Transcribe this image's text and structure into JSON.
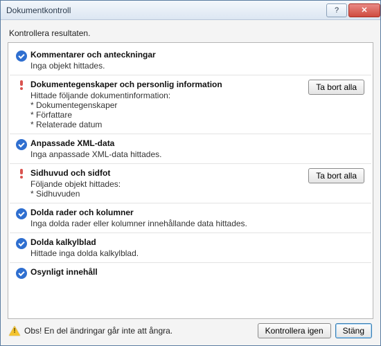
{
  "window": {
    "title": "Dokumentkontroll"
  },
  "instruction": "Kontrollera resultaten.",
  "items": [
    {
      "status": "ok",
      "title": "Kommentarer och anteckningar",
      "message": "Inga objekt hittades.",
      "details": [],
      "action": null
    },
    {
      "status": "warn",
      "title": "Dokumentegenskaper och personlig information",
      "message": "Hittade följande dokumentinformation:",
      "details": [
        "* Dokumentegenskaper",
        "* Författare",
        "* Relaterade datum"
      ],
      "action": "Ta bort alla"
    },
    {
      "status": "ok",
      "title": "Anpassade XML-data",
      "message": "Inga anpassade XML-data hittades.",
      "details": [],
      "action": null
    },
    {
      "status": "warn",
      "title": "Sidhuvud och sidfot",
      "message": "Följande objekt hittades:",
      "details": [
        "* Sidhuvuden"
      ],
      "action": "Ta bort alla"
    },
    {
      "status": "ok",
      "title": "Dolda rader och kolumner",
      "message": "Inga dolda rader eller kolumner innehållande data hittades.",
      "details": [],
      "action": null
    },
    {
      "status": "ok",
      "title": "Dolda kalkylblad",
      "message": "Hittade inga dolda kalkylblad.",
      "details": [],
      "action": null
    },
    {
      "status": "ok",
      "title": "Osynligt innehåll",
      "message": "",
      "details": [],
      "action": null
    }
  ],
  "footer": {
    "note": "Obs! En del ändringar går inte att ångra.",
    "reinspect": "Kontrollera igen",
    "close": "Stäng"
  }
}
